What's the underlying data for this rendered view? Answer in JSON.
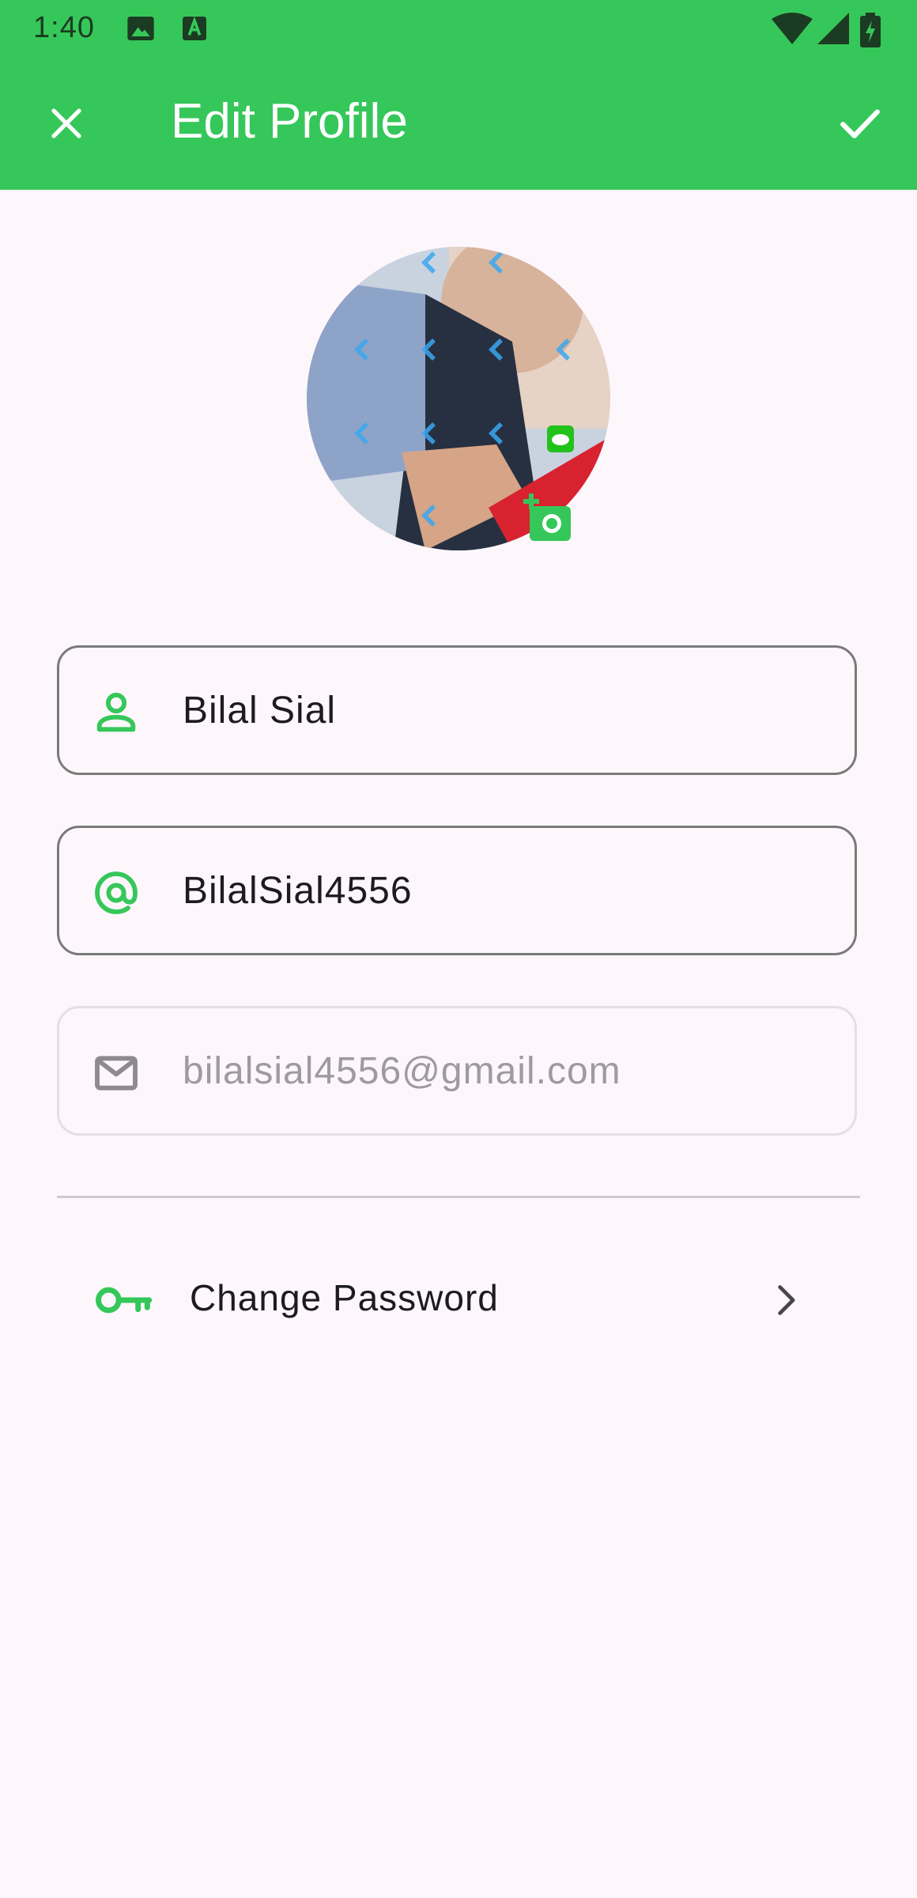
{
  "status_bar": {
    "time": "1:40"
  },
  "app_bar": {
    "title": "Edit Profile"
  },
  "form": {
    "name_value": "Bilal Sial",
    "username_value": "BilalSial4556",
    "email_value": "bilalsial4556@gmail.com"
  },
  "settings": {
    "change_password_label": "Change Password"
  },
  "colors": {
    "primary": "#36c75a",
    "background": "#fdf7fc",
    "text": "#1d1b1f",
    "muted": "#9e9aa0"
  }
}
